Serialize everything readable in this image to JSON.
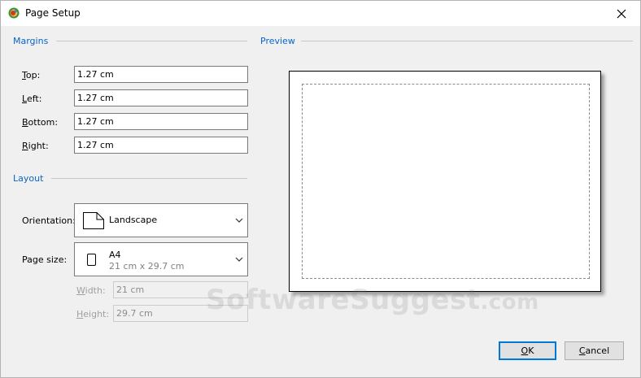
{
  "window": {
    "title": "Page Setup"
  },
  "margins": {
    "heading": "Margins",
    "fields": [
      {
        "accel": "T",
        "rest": "op:",
        "value": "1.27 cm"
      },
      {
        "accel": "L",
        "rest": "eft:",
        "value": "1.27 cm"
      },
      {
        "accel": "B",
        "rest": "ottom:",
        "value": "1.27 cm"
      },
      {
        "accel": "R",
        "rest": "ight:",
        "value": "1.27 cm"
      }
    ]
  },
  "layout": {
    "heading": "Layout",
    "orientation": {
      "label": "Orientation:",
      "value": "Landscape"
    },
    "page_size": {
      "label": "Page size:",
      "name": "A4",
      "dims": "21 cm x 29.7 cm"
    },
    "width": {
      "accel": "W",
      "rest": "idth:",
      "value": "21 cm"
    },
    "height": {
      "accel": "H",
      "rest": "eight:",
      "value": "29.7 cm"
    }
  },
  "preview": {
    "heading": "Preview"
  },
  "buttons": {
    "ok": {
      "accel": "O",
      "rest": "K"
    },
    "cancel": {
      "accel": "C",
      "rest": "ancel"
    }
  },
  "watermark": {
    "main": "SoftwareSuggest",
    "suffix": ".com"
  },
  "icons": {
    "app": "app-icon",
    "close": "close-icon",
    "chevron": "chevron-down-icon",
    "landscape_page": "landscape-page-icon",
    "portrait_page": "portrait-page-icon"
  }
}
